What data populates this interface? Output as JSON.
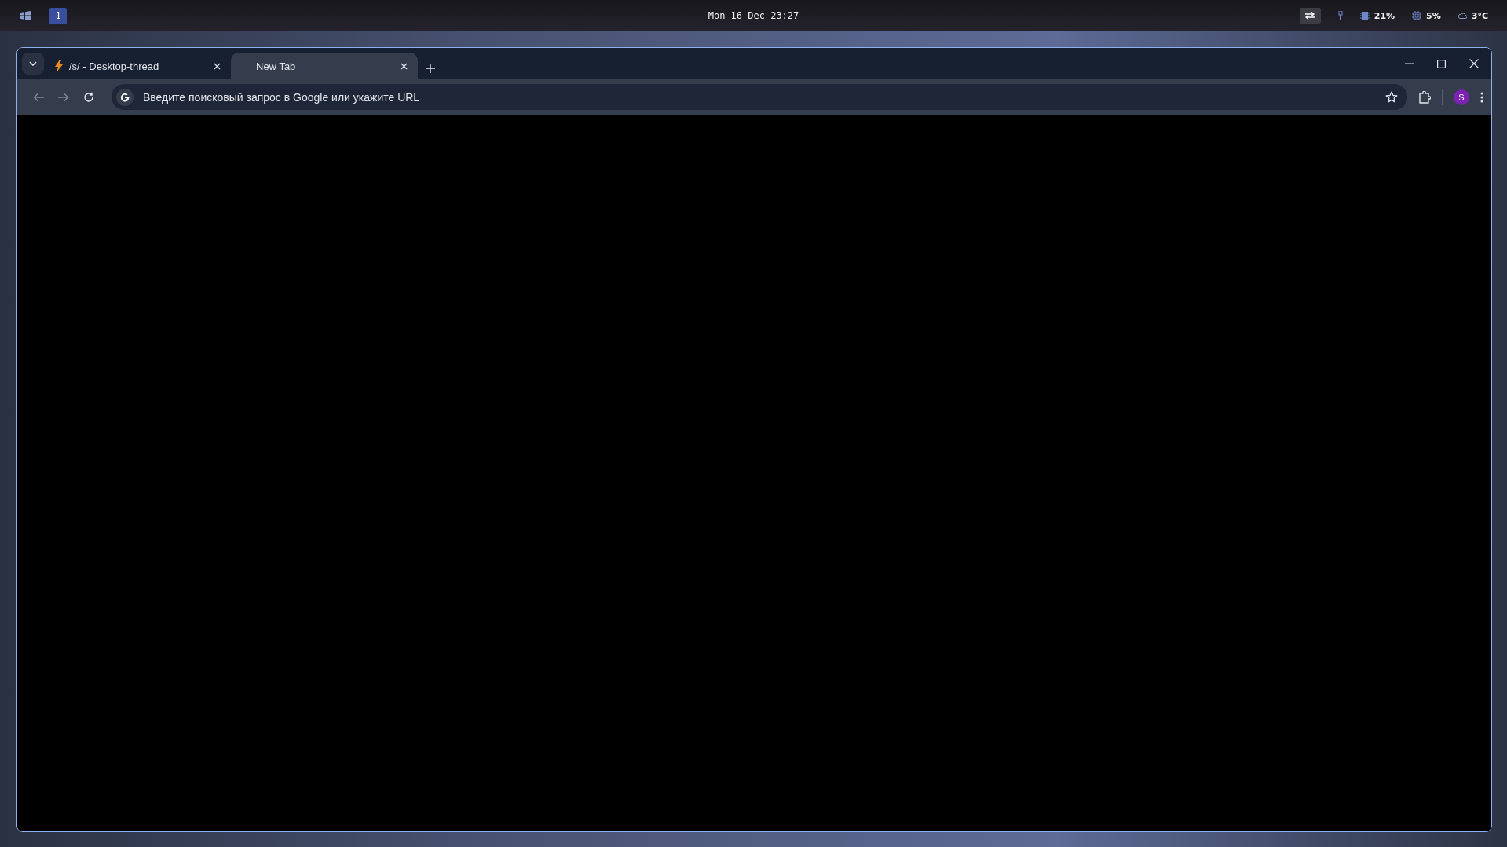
{
  "top_bar": {
    "workspaces": [
      {
        "label": "1",
        "selected": true
      }
    ],
    "clock": "Mon 16 Dec 23:27",
    "tray": [
      {
        "kind": "swap"
      },
      {
        "kind": "usb"
      },
      {
        "kind": "memory",
        "reading": "21%"
      },
      {
        "kind": "cpu",
        "reading": "5%"
      },
      {
        "kind": "weather",
        "reading": "3°C"
      }
    ]
  },
  "browser": {
    "tabs": [
      {
        "title": "/s/ - Desktop-thread",
        "selected": false
      },
      {
        "title": "New Tab",
        "selected": true
      }
    ],
    "omnibox": {
      "placeholder": "Введите поисковый запрос в Google или укажите URL"
    },
    "profile": {
      "initial": "S"
    }
  }
}
